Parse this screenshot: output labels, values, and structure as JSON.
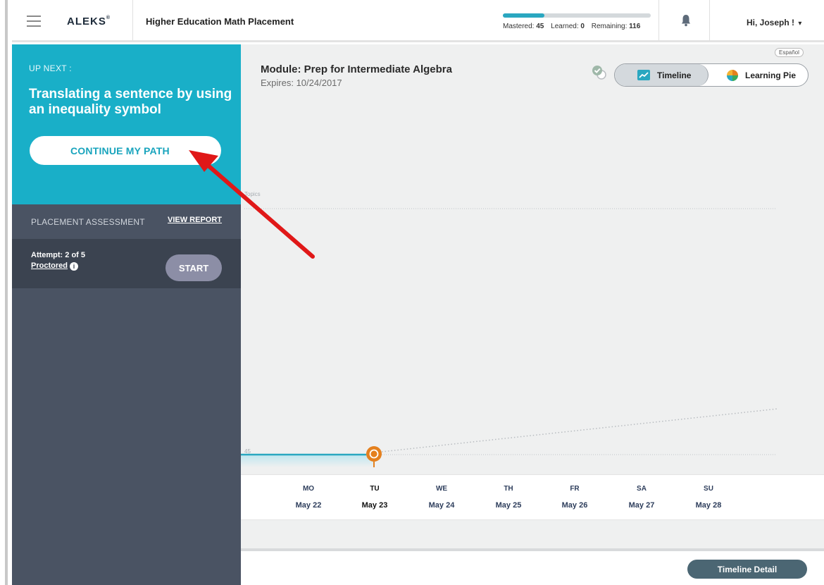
{
  "header": {
    "logo": "ALEKS",
    "logo_mark": "®",
    "course_title": "Higher Education Math Placement",
    "progress": {
      "mastered_label": "Mastered:",
      "mastered": "45",
      "learned_label": "Learned:",
      "learned": "0",
      "remaining_label": "Remaining:",
      "remaining": "116",
      "fill_fraction": 0.28
    },
    "user_greeting": "Hi, Joseph !",
    "user_caret": "▾"
  },
  "sidebar": {
    "upnext_label": "UP NEXT :",
    "topic": "Translating a sentence by using an inequality symbol",
    "continue_label": "CONTINUE MY PATH",
    "placement_label": "PLACEMENT ASSESSMENT",
    "view_report_label": "VIEW REPORT",
    "attempt": "Attempt: 2 of 5",
    "proctored": "Proctored",
    "start_label": "START"
  },
  "main": {
    "espanol": "Español",
    "module_title": "Module: Prep for Intermediate Algebra",
    "expires": "Expires: 10/24/2017",
    "toggle": {
      "timeline": "Timeline",
      "learning_pie": "Learning Pie",
      "active": "timeline"
    },
    "chart": {
      "y_label": "Topics",
      "y_value_label": "45"
    },
    "days": [
      {
        "name": "MO",
        "date": "May 22"
      },
      {
        "name": "TU",
        "date": "May 23"
      },
      {
        "name": "WE",
        "date": "May 24"
      },
      {
        "name": "TH",
        "date": "May 25"
      },
      {
        "name": "FR",
        "date": "May 26"
      },
      {
        "name": "SA",
        "date": "May 27"
      },
      {
        "name": "SU",
        "date": "May 28"
      }
    ],
    "current_day_index": 1,
    "timeline_detail_label": "Timeline Detail"
  },
  "colors": {
    "accent": "#19afc8",
    "sidebar": "#4a5363",
    "marker": "#e4801e",
    "annotation_arrow": "#e01818"
  }
}
